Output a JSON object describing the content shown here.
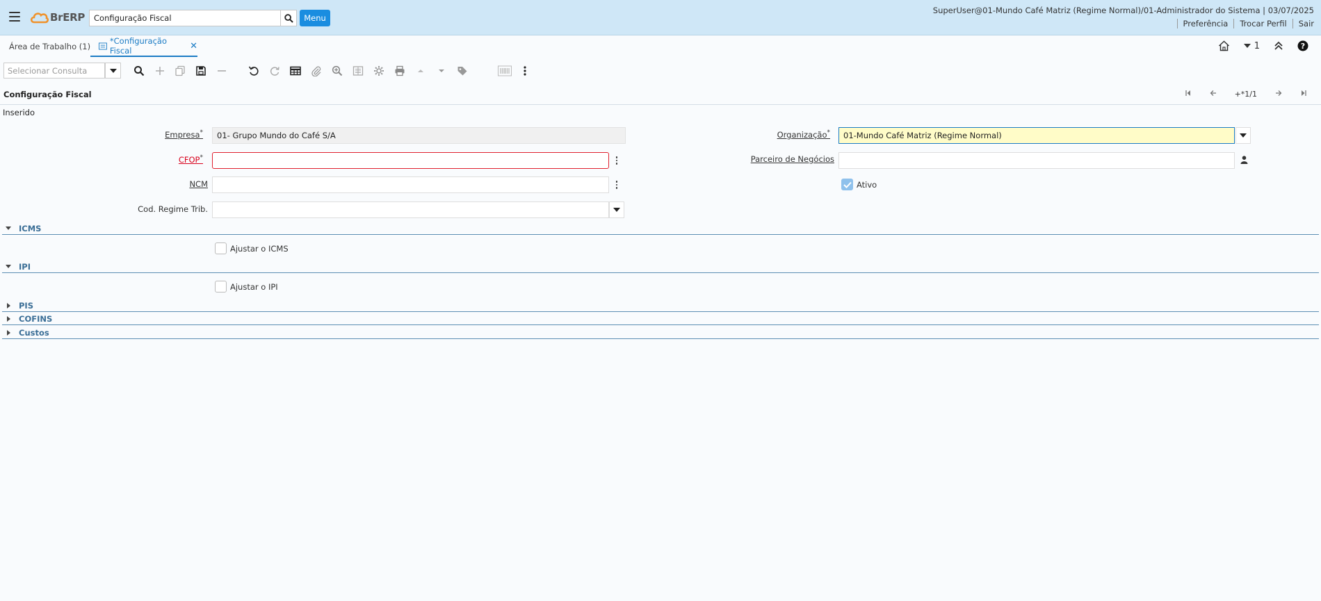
{
  "header": {
    "logo_text": "BrERP",
    "search_value": "Configuração Fiscal",
    "menu_label": "Menu",
    "user_info": "SuperUser@01-Mundo Café Matriz (Regime Normal)/01-Administrador do Sistema | 03/07/2025",
    "links": [
      "Preferência",
      "Trocar Perfil",
      "Sair"
    ]
  },
  "tabs": {
    "home": "Área de Trabalho (1)",
    "active": "*Configuração Fiscal"
  },
  "tab_icons": {
    "counter": "1"
  },
  "toolbar": {
    "query_placeholder": "Selecionar Consulta",
    "icons": [
      "search-icon",
      "add-icon",
      "copy-icon",
      "save-icon",
      "delete-icon",
      "undo-icon",
      "refresh-icon",
      "grid-toggle-icon",
      "attachment-icon",
      "zoom-icon",
      "report-icon",
      "process-icon",
      "print-icon",
      "previous-icon",
      "next-icon",
      "tag-icon",
      "barcode-icon",
      "more-icon"
    ]
  },
  "page": {
    "title": "Configuração Fiscal",
    "status": "Inserido",
    "nav_position": "+*1/1"
  },
  "form": {
    "empresa_label": "Empresa",
    "empresa_value": "01- Grupo Mundo do Café S/A",
    "cfop_label": "CFOP",
    "cfop_value": "",
    "ncm_label": "NCM",
    "ncm_value": "",
    "regime_label": "Cod. Regime Trib.",
    "regime_value": "",
    "org_label": "Organização",
    "org_value": "01-Mundo Café Matriz (Regime Normal)",
    "parceiro_label": "Parceiro de Negócios",
    "parceiro_value": "",
    "ativo_label": "Ativo",
    "ativo_checked": true
  },
  "sections": {
    "icms": {
      "label": "ICMS",
      "expanded": true,
      "checkbox_label": "Ajustar o ICMS"
    },
    "ipi": {
      "label": "IPI",
      "expanded": true,
      "checkbox_label": "Ajustar o IPI"
    },
    "pis": {
      "label": "PIS",
      "expanded": false
    },
    "cofins": {
      "label": "COFINS",
      "expanded": false
    },
    "custos": {
      "label": "Custos",
      "expanded": false
    }
  },
  "colors": {
    "header_bg": "#cfe7f7",
    "accent": "#1a7bc4",
    "menu_button": "#1a8de0",
    "error": "#e0202e",
    "highlight": "#fffcc8"
  }
}
